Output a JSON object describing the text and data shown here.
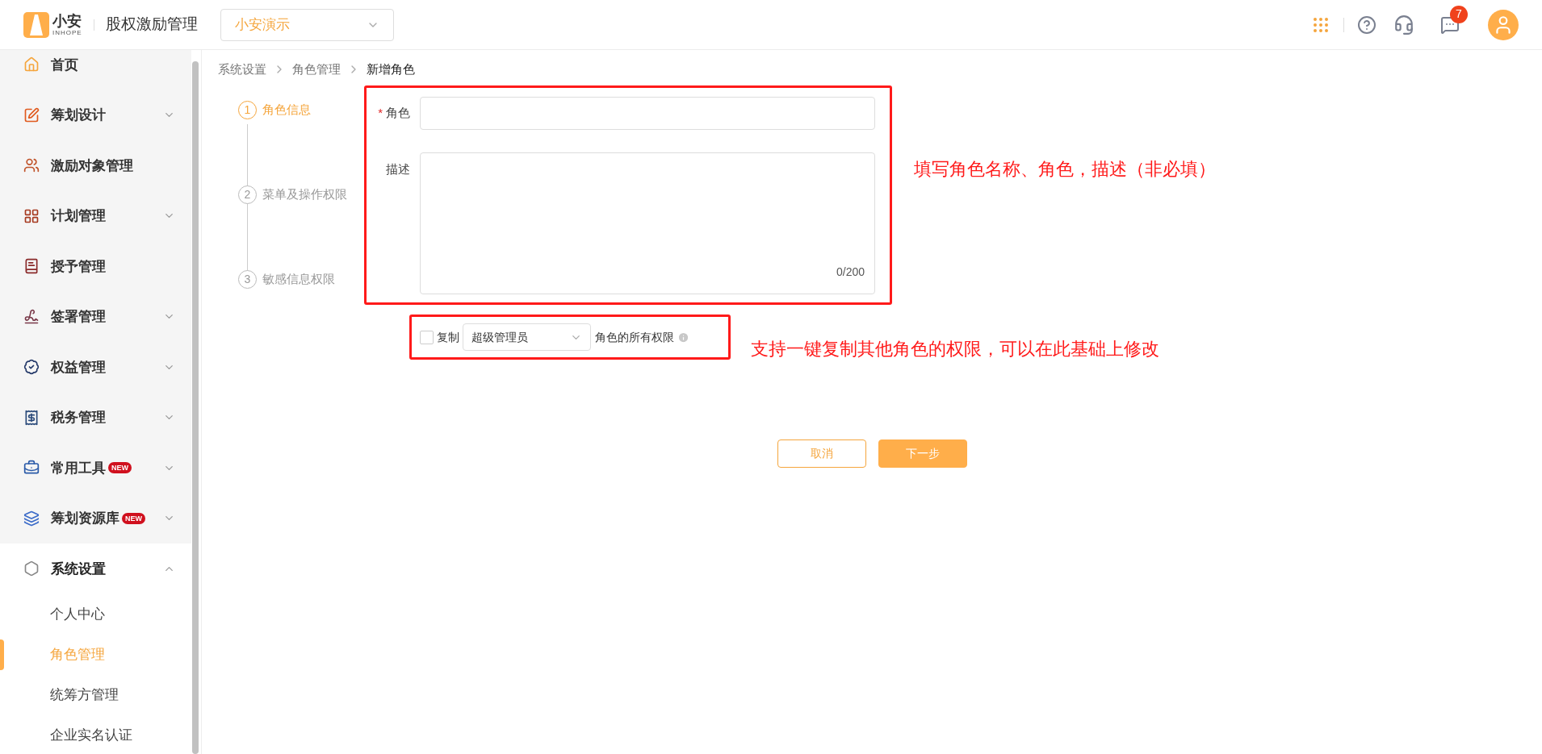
{
  "header": {
    "logo_text": "小安",
    "logo_subtext": "INHOPE",
    "title": "股权激励管理",
    "company_select": {
      "value": "小安演示"
    },
    "messages_badge": "7"
  },
  "sidebar": {
    "items": [
      {
        "label": "首页",
        "expandable": false,
        "expanded": false
      },
      {
        "label": "筹划设计",
        "expandable": true,
        "expanded": false
      },
      {
        "label": "激励对象管理",
        "expandable": false,
        "expanded": false
      },
      {
        "label": "计划管理",
        "expandable": true,
        "expanded": false
      },
      {
        "label": "授予管理",
        "expandable": false,
        "expanded": false
      },
      {
        "label": "签署管理",
        "expandable": true,
        "expanded": false
      },
      {
        "label": "权益管理",
        "expandable": true,
        "expanded": false
      },
      {
        "label": "税务管理",
        "expandable": true,
        "expanded": false
      },
      {
        "label": "常用工具",
        "badge": "NEW",
        "expandable": true,
        "expanded": false
      },
      {
        "label": "筹划资源库",
        "badge": "NEW",
        "expandable": true,
        "expanded": false
      },
      {
        "label": "系统设置",
        "expandable": true,
        "expanded": true,
        "children": [
          {
            "label": "个人中心",
            "selected": false
          },
          {
            "label": "角色管理",
            "selected": true
          },
          {
            "label": "统筹方管理",
            "selected": false
          },
          {
            "label": "企业实名认证",
            "selected": false
          }
        ]
      }
    ]
  },
  "breadcrumb": [
    "系统设置",
    "角色管理",
    "新增角色"
  ],
  "steps": [
    {
      "number": "1",
      "label": "角色信息",
      "selected": true
    },
    {
      "number": "2",
      "label": "菜单及操作权限",
      "selected": false
    },
    {
      "number": "3",
      "label": "敏感信息权限",
      "selected": false
    }
  ],
  "form": {
    "role": {
      "label": "角色",
      "required_mark": "*"
    },
    "description": {
      "label": "描述",
      "counter": "0/200"
    }
  },
  "copy_permissions": {
    "checked": false,
    "label": "复制",
    "role_select": "超级管理员",
    "suffix": "角色的所有权限"
  },
  "buttons": [
    {
      "label": "取消",
      "kind": "secondary"
    },
    {
      "label": "下一步",
      "kind": "primary"
    }
  ],
  "annotations": [
    "填写角色名称、角色，描述（非必填）",
    "支持一键复制其他角色的权限，可以在此基础上修改"
  ]
}
